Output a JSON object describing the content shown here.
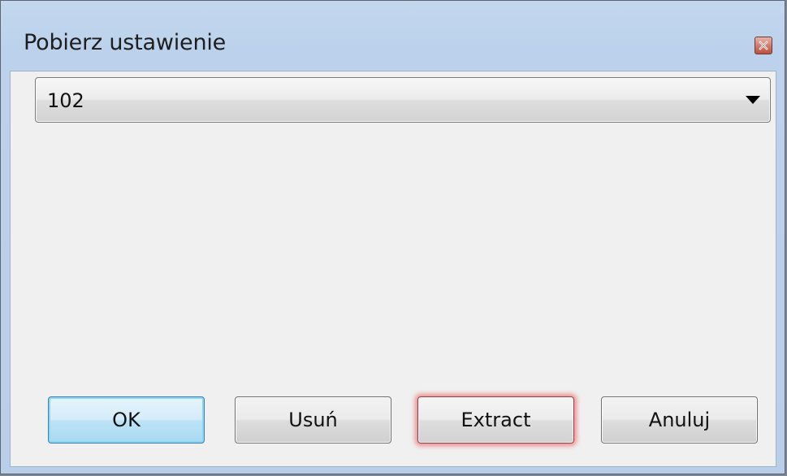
{
  "window": {
    "title": "Pobierz ustawienie",
    "close_icon": "close-icon"
  },
  "combo": {
    "value": "102",
    "arrow_icon": "chevron-down-icon"
  },
  "buttons": {
    "ok": "OK",
    "usun": "Usuń",
    "extract": "Extract",
    "anuluj": "Anuluj"
  },
  "colors": {
    "title_bar": "#bcd2ec",
    "client_bg": "#f0f0f0",
    "close_button": "#c0503d",
    "default_button_border": "#3c7fb1",
    "hot_button_glow": "#eb6e6e"
  }
}
